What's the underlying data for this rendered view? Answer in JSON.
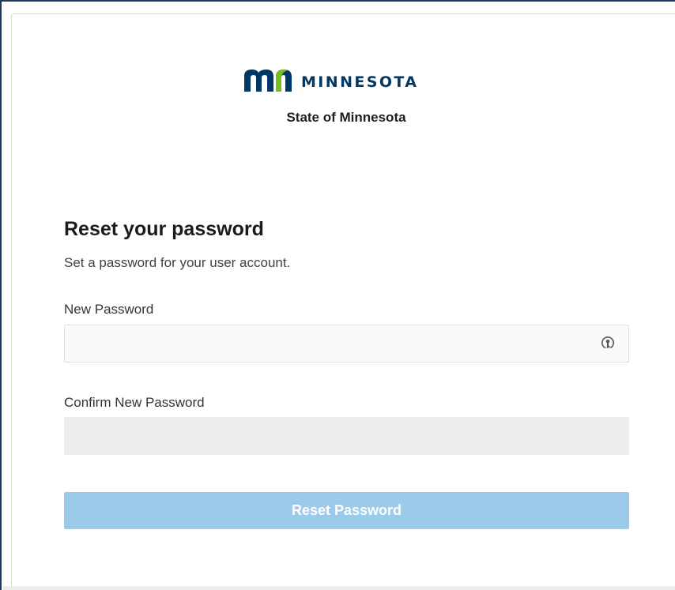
{
  "brand": {
    "wordmark": "MINNESOTA",
    "organization": "State of Minnesota",
    "logo_colors": {
      "primary": "#003865",
      "accent": "#78be21"
    }
  },
  "form": {
    "heading": "Reset your password",
    "description": "Set a password for your user account.",
    "new_password": {
      "label": "New Password",
      "value": "",
      "icon": "password-manager-key-icon"
    },
    "confirm_password": {
      "label": "Confirm New Password",
      "value": "",
      "disabled": true
    },
    "submit_label": "Reset Password",
    "submit_disabled": true
  },
  "colors": {
    "frame_border": "#1f3864",
    "button_disabled": "#9ccbea"
  }
}
